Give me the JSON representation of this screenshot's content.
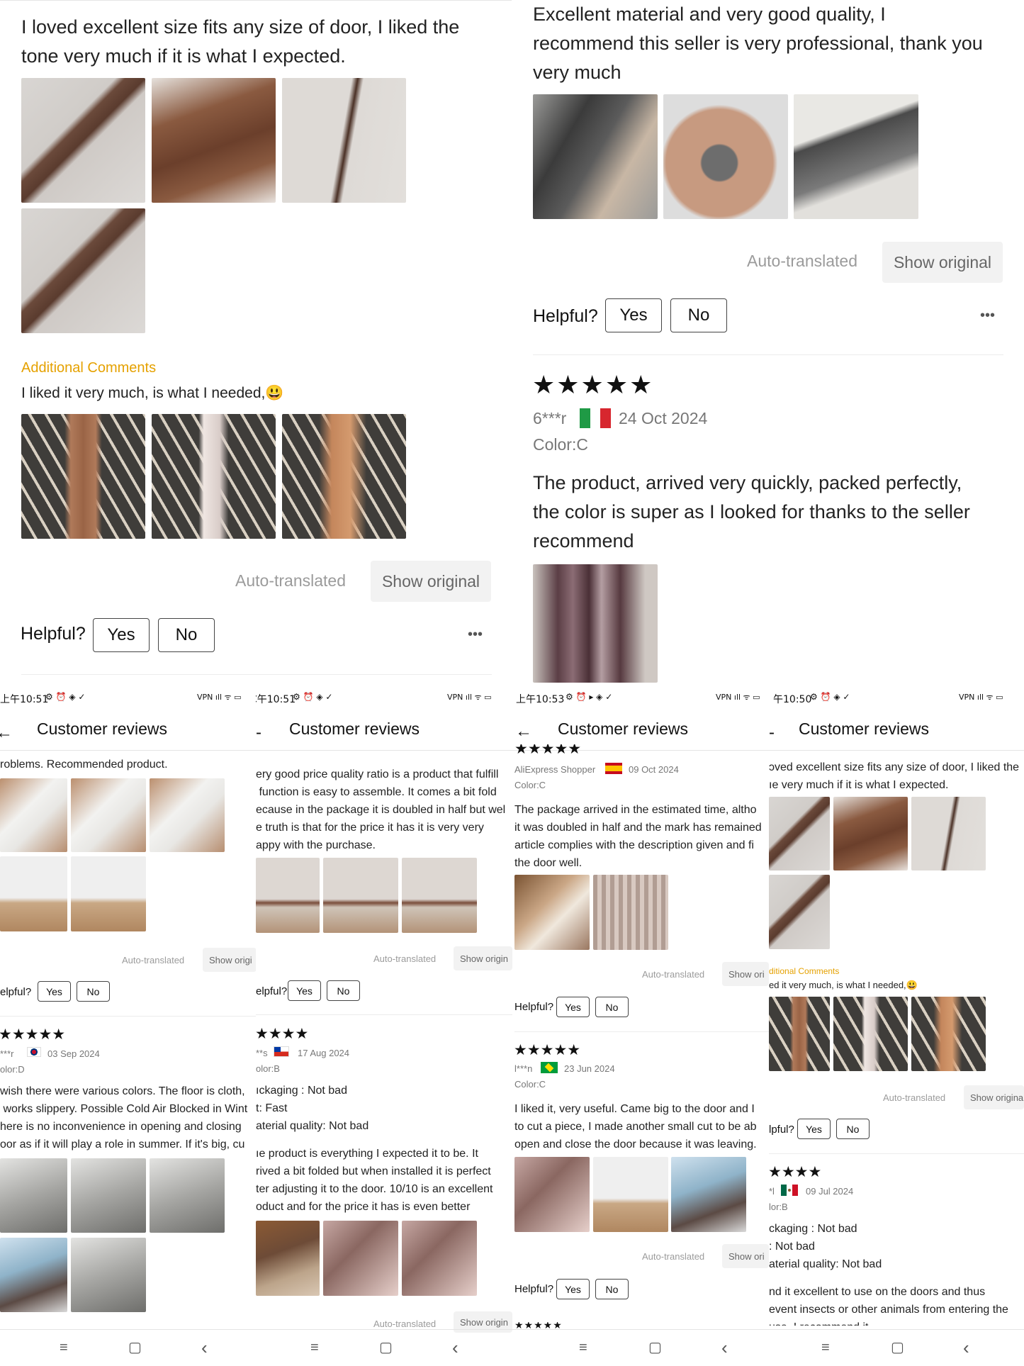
{
  "top_left": {
    "review_text": "I loved excellent size fits any size of door, I liked the\ntone very much if it is what I expected.",
    "additional_title": "Additional Comments",
    "additional_text": "I liked it very much, is what I needed,😃",
    "auto_translated": "Auto-translated",
    "show_original": "Show original",
    "helpful": "Helpful?",
    "yes": "Yes",
    "no": "No",
    "more": "•••"
  },
  "top_right": {
    "review_text": "Excellent material and very good quality, I\nrecommend this seller is very professional, thank you\nvery much",
    "auto_translated": "Auto-translated",
    "show_original": "Show original",
    "helpful": "Helpful?",
    "yes": "Yes",
    "no": "No",
    "more": "•••",
    "stars": "★★★★★",
    "user": "6***r",
    "date": "24 Oct 2024",
    "color": "Color:C",
    "review2_text": "The product, arrived very quickly, packed perfectly,\nthe color is super as I looked for thanks to the seller\nrecommend"
  },
  "panels": [
    {
      "status_time": "上午10:51",
      "status_icons_left": "⚙ ⏰ ◈ ✓",
      "status_icons_right": "VPN ıll ᯤ ▭",
      "title": "Customer reviews",
      "text_top": "roblems. Recommended product.",
      "auto": "Auto-translated",
      "show": "Show origi",
      "helpful": "elpful?",
      "yes": "Yes",
      "no": "No",
      "stars": "★★★★★",
      "user": "***r",
      "date": "03 Sep 2024",
      "color": "olor:D",
      "text2": "wish there were various colors. The floor is cloth,\n works slippery. Possible Cold Air Blocked in Wint\nhere is no inconvenience in opening and closing\noor as if it will play a role in summer. If it's big, cu",
      "nav_menu": "≡",
      "nav_home": "▢",
      "nav_back": "‹"
    },
    {
      "status_time": "C午10:51",
      "status_icons_left": "⚙ ⏰ ◈ ✓",
      "status_icons_right": "VPN ıll ᯤ ▭",
      "title": "Customer reviews",
      "text_top": "ery good price quality ratio is a product that fulfill\n function is easy to assemble. It comes a bit fold\necause in the package it is doubled in half but wel\ne truth is that for the price it has it is very very\nappy with the purchase.",
      "auto": "Auto-translated",
      "show": "Show origin",
      "helpful": "elpful?",
      "yes": "Yes",
      "no": "No",
      "stars": "★★★★",
      "user": "**s",
      "date": "17 Aug 2024",
      "color": "olor:B",
      "pack_label": "ıckaging : ",
      "pack_val": "Not bad",
      "ship_label": "t: ",
      "ship_val": "Fast",
      "mat_label": "aterial quality: ",
      "mat_val": "Not bad",
      "text2": "ıe product is everything I expected it to be. It\nrived a bit folded but when installed it is perfect\nter adjusting it to the door. 10/10 is an excellent\noduct and for the price it has is even better",
      "auto2": "Auto-translated",
      "show2": "Show origin",
      "nav_menu": "≡",
      "nav_home": "▢",
      "nav_back": "‹"
    },
    {
      "status_time": "上午10:53",
      "status_icons_left": "⚙ ⏰ ▸ ◈ ✓",
      "status_icons_right": "VPN ıll ᯤ ▭",
      "title": "Customer reviews",
      "user1": "AliExpress Shopper",
      "date1": "09 Oct 2024",
      "color1": "Color:C",
      "text1": "The package arrived in the estimated time, altho\nit was doubled in half and the mark has remained\narticle complies with the description given and fi\nthe door well.",
      "auto": "Auto-translated",
      "show": "Show ori",
      "helpful": "Helpful?",
      "yes": "Yes",
      "no": "No",
      "stars": "★★★★★",
      "user2": "l***n",
      "date2": "23 Jun 2024",
      "color2": "Color:C",
      "text2": "I liked it, very useful. Came big to the door and I\nto cut a piece, I made another small cut to be ab\nopen and close the door because it was leaving.",
      "auto2": "Auto-translated",
      "show2": "Show ori",
      "helpful2": "Helpful?",
      "yes2": "Yes",
      "no2": "No",
      "stars_bottom": "★★★★★",
      "nav_menu": "≡",
      "nav_home": "▢",
      "nav_back": "‹"
    },
    {
      "status_time": "午10:50",
      "status_icons_left": "⚙ ⏰ ◈ ✓",
      "status_icons_right": "VPN ıll ᯤ ▭",
      "title": "Customer reviews",
      "text_top": "ɔved excellent size fits any size of door, I liked the\nıe very much if it is what I expected.",
      "add_title": "ditional Comments",
      "add_text": "ed it very much, is what I needed,😃",
      "auto": "Auto-translated",
      "show": "Show origina",
      "helpful": "lpful?",
      "yes": "Yes",
      "no": "No",
      "stars": "★★★★",
      "user": "*l",
      "date": "09 Jul 2024",
      "color": "lor:B",
      "pack_label": "ckaging : ",
      "pack_val": "Not bad",
      "ship_label": ": ",
      "ship_val": "Not bad",
      "mat_label": "aterial quality: ",
      "mat_val": "Not bad",
      "text2": "nd it excellent to use on the doors and thus\nevent insects or other animals from entering the\nuse. I recommend it.",
      "nav_menu": "≡",
      "nav_home": "▢",
      "nav_back": "‹"
    }
  ],
  "colors": {
    "accent_orange": "#e5a100",
    "text": "#111111",
    "muted": "#9b9b9b"
  },
  "icons": [
    "star-icon",
    "back-arrow-icon",
    "more-dots-icon",
    "flag-icon"
  ]
}
